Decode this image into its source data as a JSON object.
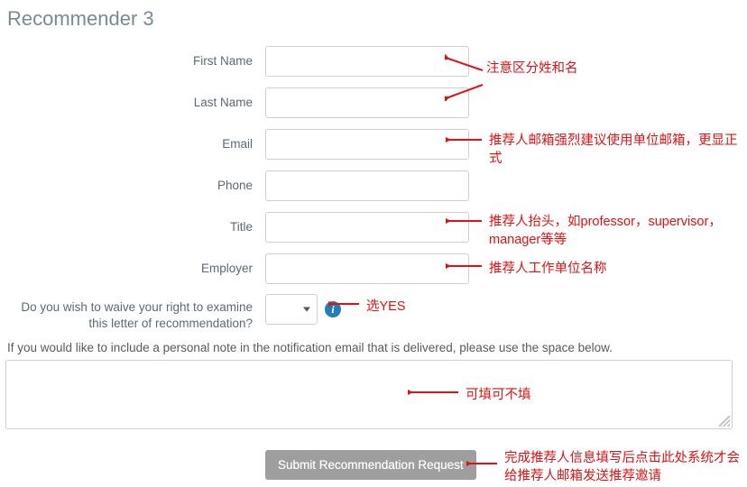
{
  "section_title": "Recommender 3",
  "fields": {
    "first_name": {
      "label": "First Name",
      "value": "",
      "placeholder": ""
    },
    "last_name": {
      "label": "Last Name",
      "value": "",
      "placeholder": ""
    },
    "email": {
      "label": "Email",
      "value": "",
      "placeholder": ""
    },
    "phone": {
      "label": "Phone",
      "value": "",
      "placeholder": ""
    },
    "title": {
      "label": "Title",
      "value": "",
      "placeholder": ""
    },
    "employer": {
      "label": "Employer",
      "value": "",
      "placeholder": ""
    },
    "waive": {
      "label": "Do you wish to waive your right to examine this letter of recommendation?",
      "value": ""
    }
  },
  "note_instruction": "If you would like to include a personal note in the notification email that is delivered, please use the space below.",
  "note_value": "",
  "submit_label": "Submit Recommendation Request",
  "annotations": {
    "name_join": "注意区分姓和名",
    "email": "推荐人邮箱强烈建议使用单位邮箱，更显正式",
    "title": "推荐人抬头，如professor，supervisor，manager等等",
    "employer": "推荐人工作单位名称",
    "waive": "选YES",
    "note": "可填可不填",
    "submit": "完成推荐人信息填写后点击此处系统才会给推荐人邮箱发送推荐邀请"
  },
  "colors": {
    "annotation_red": "#e21212",
    "heading_gray": "#7a8a95",
    "label_gray": "#5a6a78",
    "button_gray": "#9e9e9e",
    "info_blue": "#1f7fb8"
  }
}
